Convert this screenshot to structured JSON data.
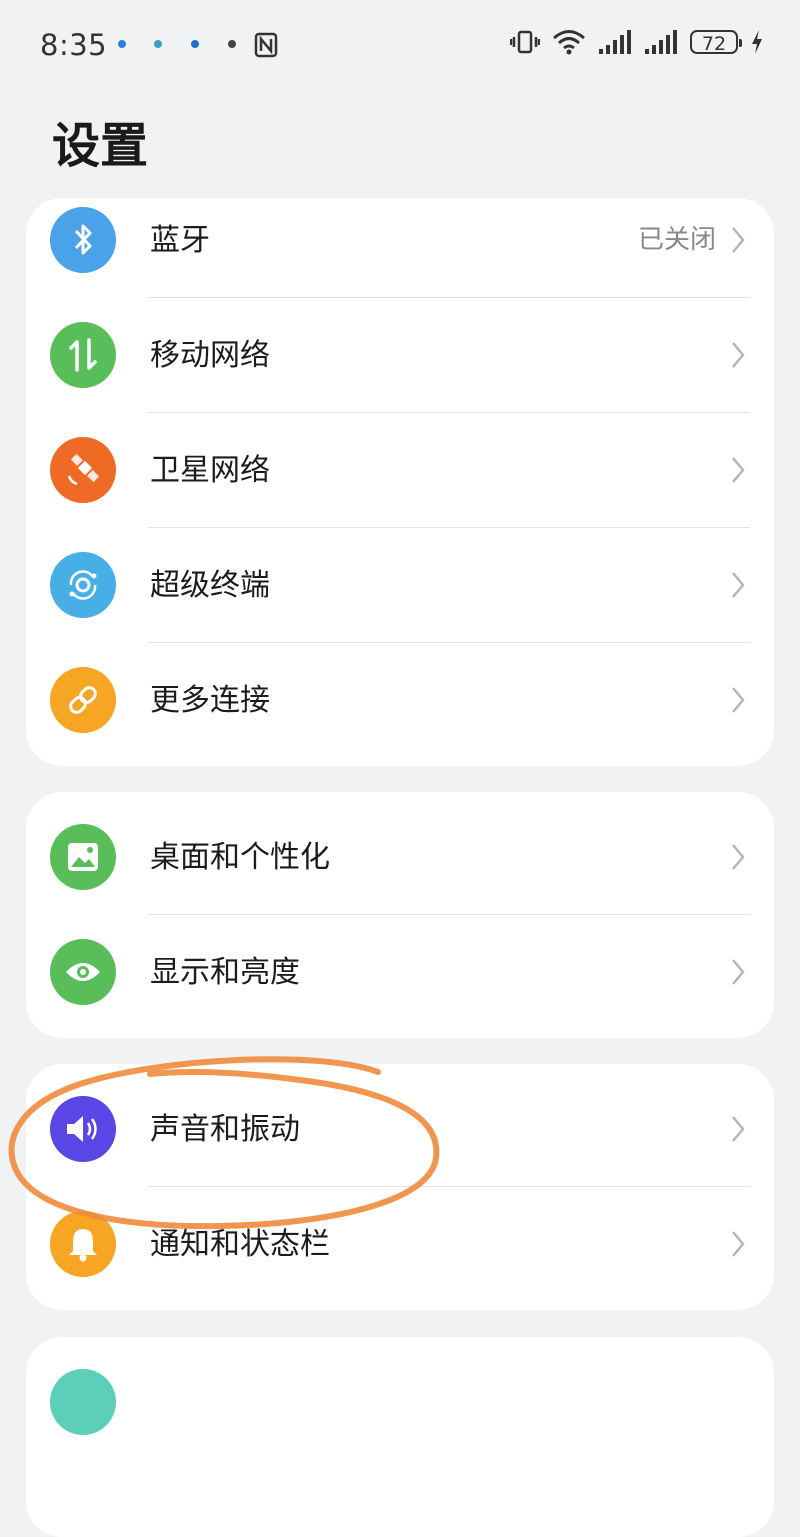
{
  "status_bar": {
    "time": "8:35",
    "battery": "72",
    "icons": [
      "notification-icon",
      "notification-icon",
      "notification-icon",
      "notification-icon",
      "nfc-icon",
      "vibrate-icon",
      "wifi-icon",
      "signal-icon",
      "signal-icon",
      "battery-icon",
      "charging-icon"
    ]
  },
  "page": {
    "title": "设置"
  },
  "sections": [
    {
      "items": [
        {
          "label": "蓝牙",
          "value": "已关闭",
          "icon": "bluetooth-icon",
          "color": "#4aa3e8"
        },
        {
          "label": "移动网络",
          "icon": "mobile-network-icon",
          "color": "#59bd5a"
        },
        {
          "label": "卫星网络",
          "icon": "satellite-icon",
          "color": "#ef6a25"
        },
        {
          "label": "超级终端",
          "icon": "super-device-icon",
          "color": "#47aee6"
        },
        {
          "label": "更多连接",
          "icon": "link-icon",
          "color": "#f6a623"
        }
      ]
    },
    {
      "items": [
        {
          "label": "桌面和个性化",
          "icon": "wallpaper-icon",
          "color": "#59bd5a"
        },
        {
          "label": "显示和亮度",
          "icon": "eye-icon",
          "color": "#59bd5a"
        }
      ]
    },
    {
      "items": [
        {
          "label": "声音和振动",
          "icon": "speaker-icon",
          "color": "#5a45e6"
        },
        {
          "label": "通知和状态栏",
          "icon": "bell-icon",
          "color": "#f6a623"
        }
      ]
    },
    {
      "items": [
        {
          "icon": "settings-item-icon",
          "color": "#5ccfb9"
        }
      ]
    }
  ],
  "colors": {
    "background": "#f1f2f4",
    "card": "#ffffff",
    "annotation": "#f08a3c"
  }
}
